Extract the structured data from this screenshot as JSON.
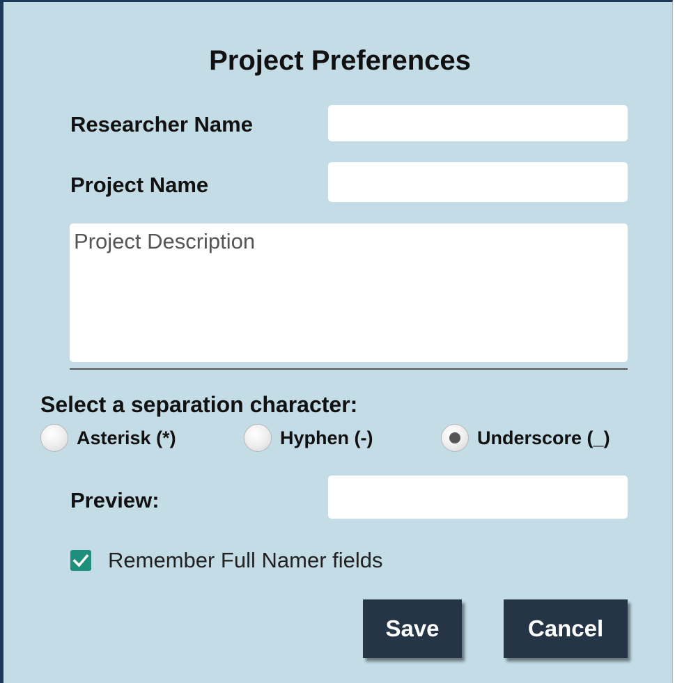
{
  "dialog": {
    "title": "Project Preferences"
  },
  "form": {
    "researcher_label": "Researcher Name",
    "researcher_value": "",
    "project_label": "Project Name",
    "project_value": "",
    "description_placeholder": "Project Description",
    "description_value": ""
  },
  "separator": {
    "title": "Select a separation character:",
    "options": [
      {
        "label": "Asterisk (*)",
        "selected": false
      },
      {
        "label": "Hyphen (-)",
        "selected": false
      },
      {
        "label": "Underscore (_)",
        "selected": true
      }
    ]
  },
  "preview": {
    "label": "Preview:",
    "value": ""
  },
  "remember": {
    "label": "Remember Full Namer fields",
    "checked": true,
    "icon": "checkmark-icon",
    "color": "#1d8f7b"
  },
  "buttons": {
    "save_label": "Save",
    "cancel_label": "Cancel",
    "color": "#263546"
  },
  "theme": {
    "background": "#c3dce6",
    "border": "#1c3a57"
  }
}
